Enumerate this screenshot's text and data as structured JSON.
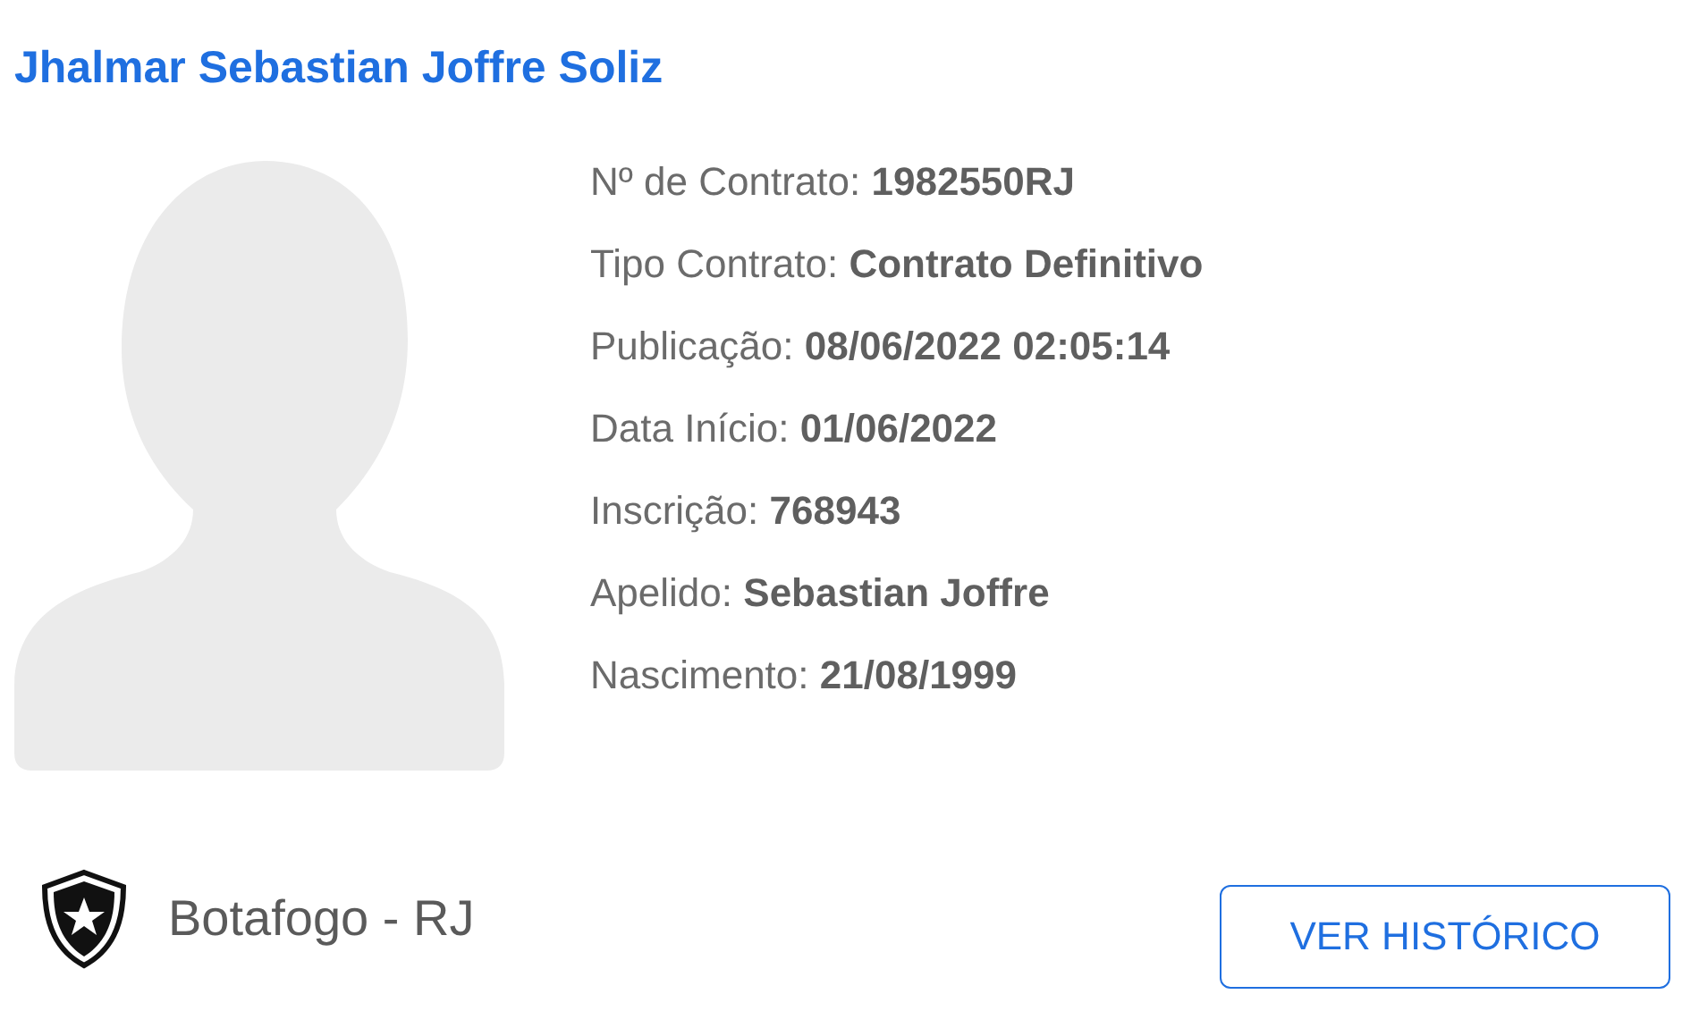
{
  "player_name": "Jhalmar Sebastian Joffre Soliz",
  "details": [
    {
      "label": "Nº de Contrato:",
      "value": "1982550RJ"
    },
    {
      "label": "Tipo Contrato:",
      "value": "Contrato Definitivo"
    },
    {
      "label": "Publicação:",
      "value": "08/06/2022 02:05:14"
    },
    {
      "label": "Data Início:",
      "value": "01/06/2022"
    },
    {
      "label": "Inscrição:",
      "value": "768943"
    },
    {
      "label": "Apelido:",
      "value": "Sebastian Joffre"
    },
    {
      "label": "Nascimento:",
      "value": "21/08/1999"
    }
  ],
  "club": "Botafogo - RJ",
  "history_button": "VER HISTÓRICO"
}
